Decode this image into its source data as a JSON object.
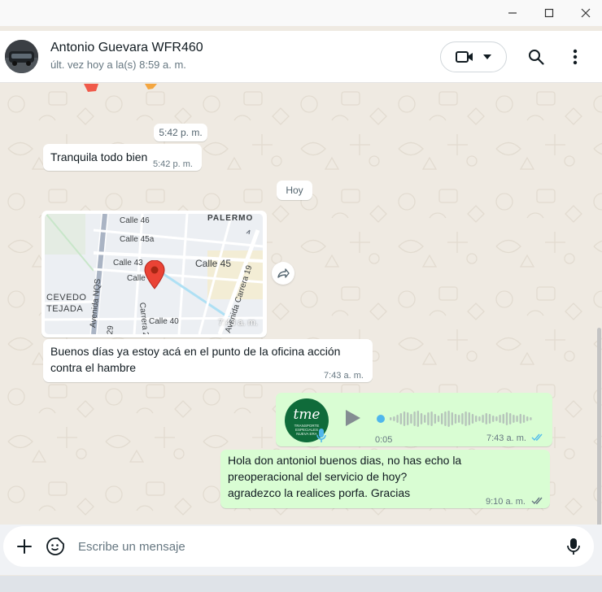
{
  "window": {
    "controls": [
      "minimize",
      "maximize",
      "close"
    ]
  },
  "header": {
    "contact_name": "Antonio Guevara WFR460",
    "last_seen": "últ. vez hoy a la(s) 8:59 a. m.",
    "icons": [
      "video-camera-icon",
      "chevron-down-icon",
      "search-icon",
      "more-vert-icon"
    ]
  },
  "chat": {
    "messages": [
      {
        "type": "time-pill",
        "text": "5:42 p. m."
      },
      {
        "type": "incoming-text",
        "text": "Tranquila todo bien",
        "time": "5:42 p. m."
      },
      {
        "type": "date-pill",
        "text": "Hoy"
      },
      {
        "type": "incoming-location",
        "map_labels": [
          "Calle 46",
          "Calle 45a",
          "Calle 43",
          "Calle 45",
          "Calle",
          "CEVEDO",
          "TEJADA",
          "Avenida NQS",
          "Carrera 2",
          "Avenida Carrera 19",
          "Calle 40",
          "29",
          "PALERMO"
        ],
        "time": "7:43 a. m."
      },
      {
        "type": "incoming-text",
        "text": "Buenos días ya estoy acá en el punto  de la oficina acción contra el hambre",
        "time": "7:43 a. m."
      },
      {
        "type": "outgoing-voice",
        "avatar_brand": "tme",
        "avatar_subtext": "TRANSPORTE ESPECIALES NUEVA ERA",
        "duration": "0:05",
        "time": "7:43 a. m.",
        "status": "read"
      },
      {
        "type": "outgoing-text",
        "lines": [
          "Hola don antoniol buenos dias, no has echo la",
          "preoperacional del servicio de hoy?",
          "agradezco la realices porfa. Gracias"
        ],
        "time": "9:10 a. m.",
        "status": "read"
      }
    ]
  },
  "composer": {
    "placeholder": "Escribe un mensaje",
    "value": ""
  },
  "colors": {
    "chat_bg": "#efeae2",
    "incoming_bubble": "#ffffff",
    "outgoing_bubble": "#d9fdd3",
    "read_ticks": "#53bdeb",
    "voice_accent": "#4fb6ec",
    "map_pin": "#ea4335"
  }
}
